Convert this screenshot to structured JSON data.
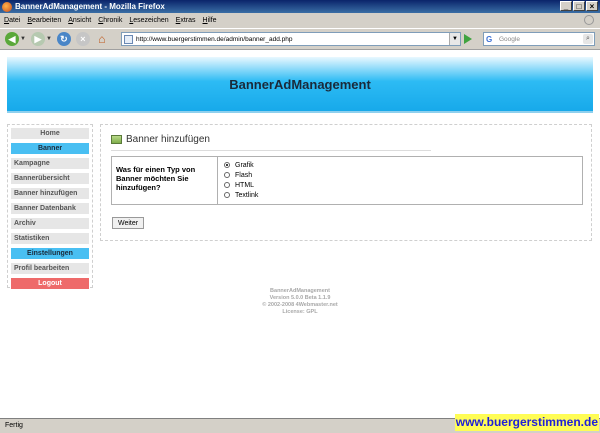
{
  "window": {
    "title": "BannerAdManagement - Mozilla Firefox"
  },
  "menu": [
    "Datei",
    "Bearbeiten",
    "Ansicht",
    "Chronik",
    "Lesezeichen",
    "Extras",
    "Hilfe"
  ],
  "toolbar": {
    "url": "http://www.buergerstimmen.de/admin/banner_add.php",
    "search_placeholder": "Google"
  },
  "app": {
    "title": "BannerAdManagement"
  },
  "sidebar": {
    "items": [
      {
        "label": "Home"
      },
      {
        "label": "Banner"
      },
      {
        "label": "Kampagne"
      },
      {
        "label": "Bannerübersicht"
      },
      {
        "label": "Banner hinzufügen"
      },
      {
        "label": "Banner Datenbank"
      },
      {
        "label": "Archiv"
      },
      {
        "label": "Statistiken"
      },
      {
        "label": "Einstellungen"
      },
      {
        "label": "Profil bearbeiten"
      },
      {
        "label": "Logout"
      }
    ]
  },
  "main": {
    "heading": "Banner hinzufügen",
    "question": "Was für einen Typ von Banner möchten Sie hinzufügen?",
    "options": [
      "Grafik",
      "Flash",
      "HTML",
      "Textlink"
    ],
    "selected": "Grafik",
    "submit_label": "Weiter"
  },
  "footer": {
    "line1": "BannerAdManagement",
    "line2": "Version 5.0.0 Beta 1.1.9",
    "line3": "© 2002-2008 4Webmaster.net",
    "line4": "License: GPL"
  },
  "status": {
    "text": "Fertig"
  },
  "watermark": "www.buergerstimmen.de"
}
